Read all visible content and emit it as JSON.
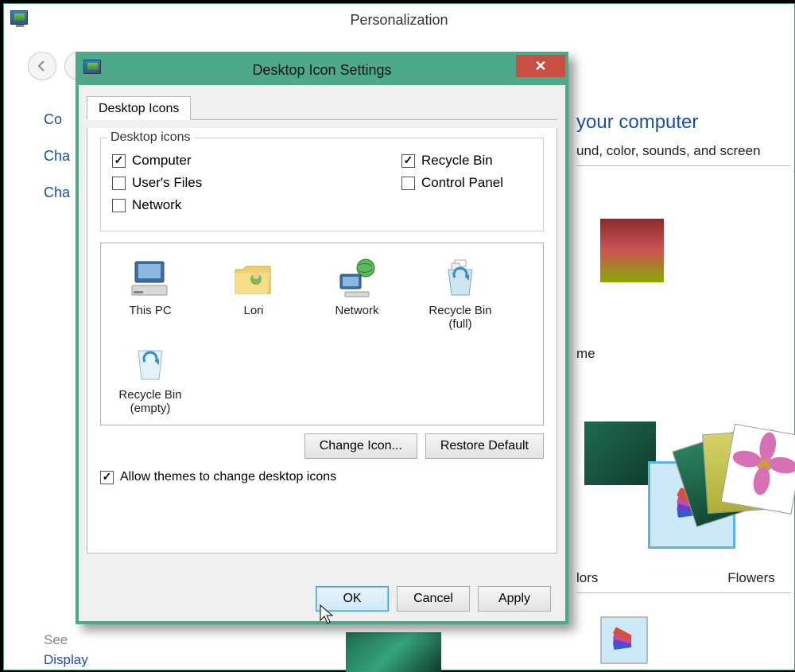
{
  "parent": {
    "title": "Personalization",
    "heading_right": "your computer",
    "sub_right": "und, color, sounds, and screen",
    "label_me": "me",
    "label_lors": "lors",
    "label_flowers": "Flowers",
    "see_also": "See",
    "display_link": "Display",
    "sidebar": {
      "i1": "Co",
      "i2": "Cha",
      "i3": "Cha"
    }
  },
  "dialog": {
    "title": "Desktop Icon Settings",
    "tab_label": "Desktop Icons",
    "fieldset_legend": "Desktop icons",
    "checks": {
      "computer": "Computer",
      "users_files": "User's Files",
      "network": "Network",
      "recycle_bin": "Recycle Bin",
      "control_panel": "Control Panel"
    },
    "preview": {
      "this_pc": "This PC",
      "lori": "Lori",
      "network": "Network",
      "rb_full_l1": "Recycle Bin",
      "rb_full_l2": "(full)",
      "rb_empty_l1": "Recycle Bin",
      "rb_empty_l2": "(empty)"
    },
    "change_icon": "Change Icon...",
    "restore_default": "Restore Default",
    "allow_themes": "Allow themes to change desktop icons",
    "ok": "OK",
    "cancel": "Cancel",
    "apply": "Apply"
  }
}
